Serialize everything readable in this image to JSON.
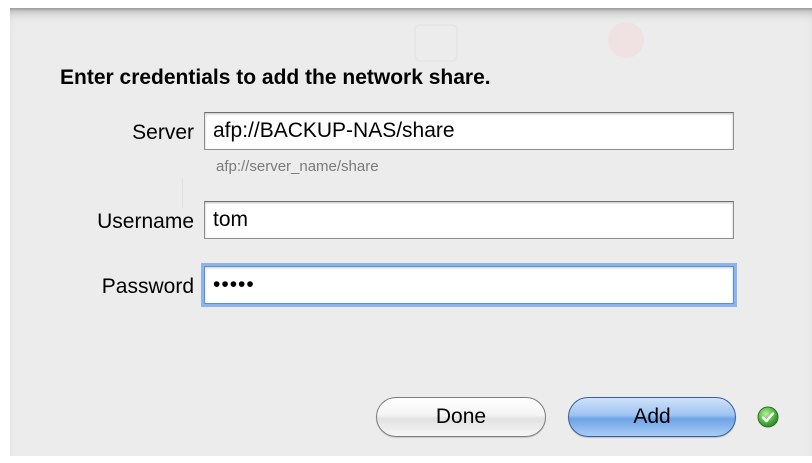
{
  "dialog": {
    "title": "Enter credentials to add the network share."
  },
  "server": {
    "label": "Server",
    "value": "afp://BACKUP-NAS/share",
    "hint": "afp://server_name/share"
  },
  "username": {
    "label": "Username",
    "value": "tom"
  },
  "password": {
    "label": "Password",
    "value": "•••••"
  },
  "buttons": {
    "done_label": "Done",
    "add_label": "Add"
  },
  "status": {
    "icon": "green-check-icon",
    "color": "#3fa23a"
  },
  "colors": {
    "focus_ring": "#8fb4ec",
    "default_button": "#6ea3e6"
  }
}
